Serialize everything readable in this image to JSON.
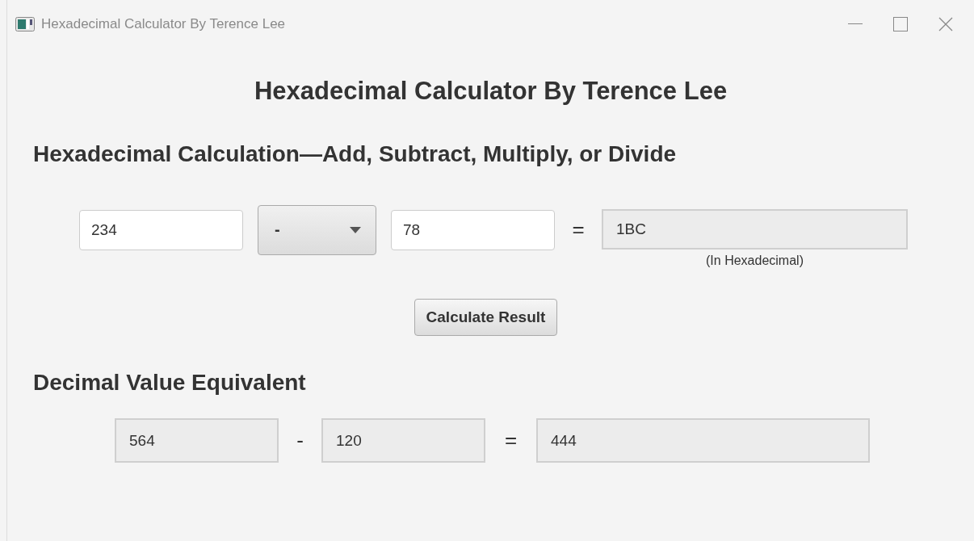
{
  "window": {
    "title": "Hexadecimal Calculator By Terence Lee"
  },
  "heading": "Hexadecimal Calculator By Terence Lee",
  "hex_section": {
    "title": "Hexadecimal Calculation—Add, Subtract, Multiply, or Divide",
    "operand_1": "234",
    "operator": "-",
    "operand_2": "78",
    "equals": "=",
    "result": "1BC",
    "result_caption": "(In Hexadecimal)"
  },
  "calculate_button": "Calculate Result",
  "decimal_section": {
    "title": "Decimal Value Equivalent",
    "operand_1": "564",
    "operator": "-",
    "operand_2": "120",
    "equals": "=",
    "result": "444"
  }
}
